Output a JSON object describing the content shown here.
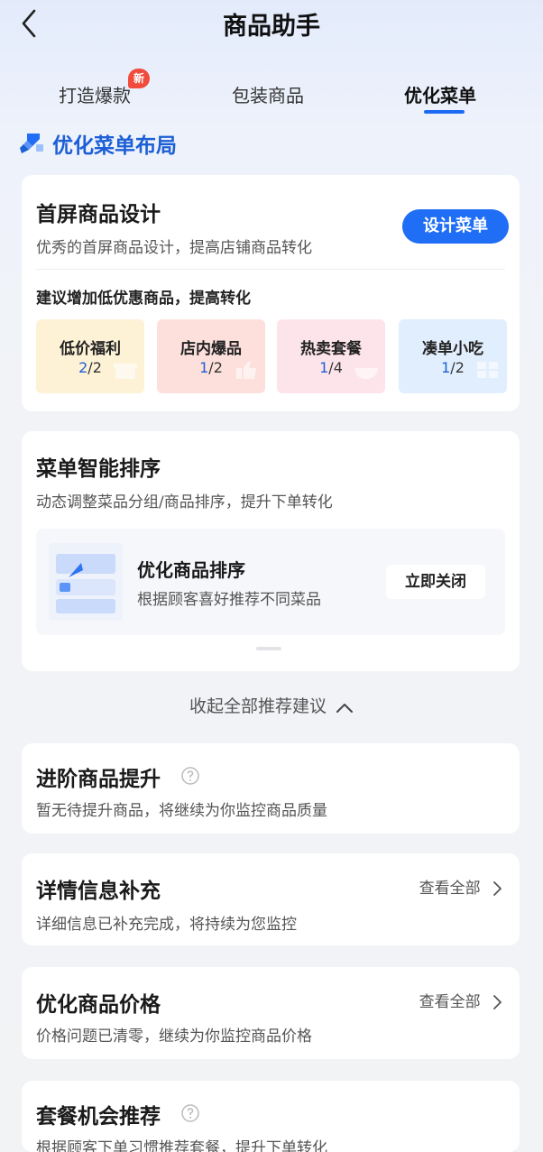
{
  "header": {
    "title": "商品助手"
  },
  "tabs": [
    {
      "label": "打造爆款",
      "badge": "新"
    },
    {
      "label": "包装商品"
    },
    {
      "label": "优化菜单"
    }
  ],
  "section": {
    "title": "优化菜单布局"
  },
  "first_screen": {
    "title": "首屏商品设计",
    "desc": "优秀的首屏商品设计，提高店铺商品转化",
    "button": "设计菜单",
    "suggest": "建议增加低优惠商品，提高转化",
    "chips": [
      {
        "name": "低价福利",
        "cur": "2",
        "total": "/2",
        "bg": "#fdf1d6"
      },
      {
        "name": "店内爆品",
        "cur": "1",
        "total": "/2",
        "bg": "#fde0dc"
      },
      {
        "name": "热卖套餐",
        "cur": "1",
        "total": "/4",
        "bg": "#fde4ea"
      },
      {
        "name": "凑单小吃",
        "cur": "1",
        "total": "/2",
        "bg": "#e1eefd"
      }
    ]
  },
  "smart_sort": {
    "title": "菜单智能排序",
    "desc": "动态调整菜品分组/商品排序，提升下单转化",
    "item_title": "优化商品排序",
    "item_desc": "根据顾客喜好推荐不同菜品",
    "item_button": "立即关闭"
  },
  "collapse_label": "收起全部推荐建议",
  "advanced": {
    "title": "进阶商品提升",
    "desc": "暂无待提升商品，将继续为你监控商品质量"
  },
  "detail_info": {
    "title": "详情信息补充",
    "desc": "详细信息已补充完成，将持续为您监控",
    "link": "查看全部"
  },
  "price": {
    "title": "优化商品价格",
    "desc": "价格问题已清零，继续为你监控商品价格",
    "link": "查看全部"
  },
  "combo": {
    "title": "套餐机会推荐",
    "desc": "根据顾客下单习惯推荐套餐，提升下单转化"
  },
  "colors": {
    "accent": "#1f6ef5",
    "badge": "#f14b3d",
    "section_title": "#1c5fd6"
  }
}
